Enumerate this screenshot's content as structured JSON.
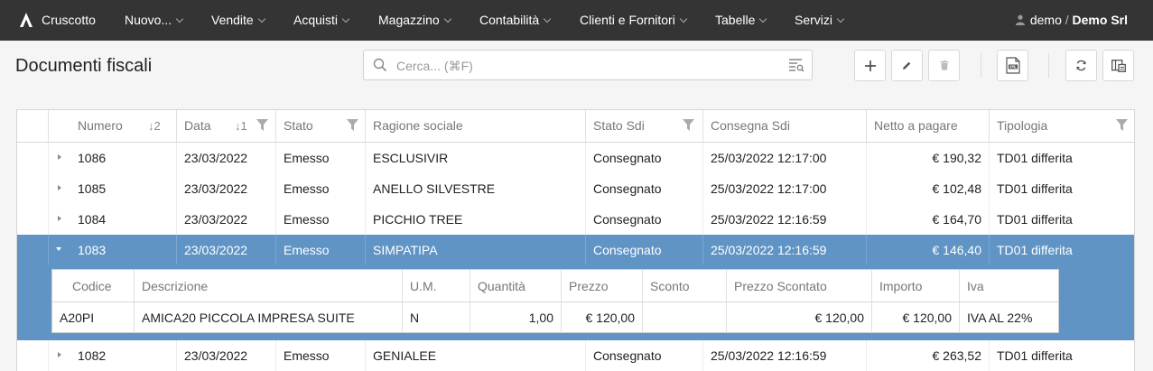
{
  "nav": {
    "brand": "Cruscotto",
    "items": [
      {
        "label": "Nuovo..."
      },
      {
        "label": "Vendite"
      },
      {
        "label": "Acquisti"
      },
      {
        "label": "Magazzino"
      },
      {
        "label": "Contabilità"
      },
      {
        "label": "Clienti e Fornitori"
      },
      {
        "label": "Tabelle"
      },
      {
        "label": "Servizi"
      }
    ],
    "user": "demo",
    "separator": "/",
    "company": "Demo Srl"
  },
  "page": {
    "title": "Documenti fiscali",
    "search_placeholder": "Cerca... (⌘F)"
  },
  "grid": {
    "headers": {
      "numero": "Numero",
      "numero_sort": "↓2",
      "data": "Data",
      "data_sort": "↓1",
      "stato": "Stato",
      "ragione": "Ragione sociale",
      "stato_sdi": "Stato Sdi",
      "consegna": "Consegna Sdi",
      "netto": "Netto a pagare",
      "tipologia": "Tipologia"
    },
    "rows": [
      {
        "numero": "1086",
        "data": "23/03/2022",
        "stato": "Emesso",
        "ragione": "ESCLUSIVIR",
        "stato_sdi": "Consegnato",
        "consegna": "25/03/2022 12:17:00",
        "netto": "€ 190,32",
        "tipologia": "TD01 differita"
      },
      {
        "numero": "1085",
        "data": "23/03/2022",
        "stato": "Emesso",
        "ragione": "ANELLO SILVESTRE",
        "stato_sdi": "Consegnato",
        "consegna": "25/03/2022 12:17:00",
        "netto": "€ 102,48",
        "tipologia": "TD01 differita"
      },
      {
        "numero": "1084",
        "data": "23/03/2022",
        "stato": "Emesso",
        "ragione": "PICCHIO TREE",
        "stato_sdi": "Consegnato",
        "consegna": "25/03/2022 12:16:59",
        "netto": "€ 164,70",
        "tipologia": "TD01 differita"
      },
      {
        "numero": "1083",
        "data": "23/03/2022",
        "stato": "Emesso",
        "ragione": "SIMPATIPA",
        "stato_sdi": "Consegnato",
        "consegna": "25/03/2022 12:16:59",
        "netto": "€ 146,40",
        "tipologia": "TD01 differita"
      },
      {
        "numero": "1082",
        "data": "23/03/2022",
        "stato": "Emesso",
        "ragione": "GENIALEE",
        "stato_sdi": "Consegnato",
        "consegna": "25/03/2022 12:16:59",
        "netto": "€ 263,52",
        "tipologia": "TD01 differita"
      }
    ],
    "detail": {
      "headers": {
        "codice": "Codice",
        "descrizione": "Descrizione",
        "um": "U.M.",
        "quantita": "Quantità",
        "prezzo": "Prezzo",
        "sconto": "Sconto",
        "prezzo_scontato": "Prezzo Scontato",
        "importo": "Importo",
        "iva": "Iva"
      },
      "row": {
        "codice": "A20PI",
        "descrizione": "AMICA20 PICCOLA IMPRESA SUITE",
        "um": "N",
        "quantita": "1,00",
        "prezzo": "€ 120,00",
        "sconto": "",
        "prezzo_scontato": "€ 120,00",
        "importo": "€ 120,00",
        "iva": "IVA AL 22%"
      }
    }
  },
  "colors": {
    "topbar": "#343434",
    "selected_row": "#5f94c5"
  }
}
